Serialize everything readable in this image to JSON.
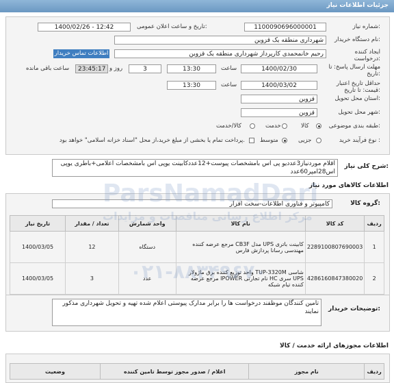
{
  "header": {
    "title": "جزئیات اطلاعات نیاز"
  },
  "form": {
    "need_number_label": "شماره نیاز:",
    "need_number": "1100090696000001",
    "announce_label": "تاریخ و ساعت اعلان عمومی:",
    "announce_value": "1400/02/26 - 12:42",
    "buyer_label": "نام دستگاه خریدار:",
    "buyer_value": "شهرداری منطقه یک قزوین",
    "creator_label": "ایجاد کننده درخواست:",
    "creator_value": "رحیم خانمحمدی کارپرداز شهرداری منطقه یک قزوین",
    "contact_link": "اطلاعات تماس خریدار",
    "deadline_label": "مهلت ارسال پاسخ: تا تاریخ:",
    "deadline_date": "1400/02/30",
    "time_label": "ساعت",
    "deadline_time": "13:30",
    "days_value": "3",
    "days_label": "روز و",
    "remaining_time": "23:45:17",
    "remaining_label": "ساعت باقی مانده",
    "validity_label": "حداقل تاریخ اعتبار قیمت: تا تاریخ:",
    "validity_date": "1400/03/02",
    "validity_time": "13:30",
    "province_label": "استان محل تحویل:",
    "province_value": "قزوین",
    "city_label": "شهر محل تحویل:",
    "city_value": "قزوین",
    "category_label": "طبقه بندی موضوعی:",
    "category_options": [
      "کالا",
      "خدمت",
      "کالا/خدمت"
    ],
    "category_selected": "کالا",
    "process_label": "نوع فرآیند خرید :",
    "process_options": [
      "جزیی",
      "متوسط"
    ],
    "process_selected": "متوسط",
    "payment_text": "پرداخت تمام یا بخشی از مبلغ خرید،از محل \"اسناد خزانه اسلامی\" خواهد بود."
  },
  "summary": {
    "label": "شرح کلی نیاز:",
    "text": "اقلام موردنیاز3عددیو پی اس بامشخصات پیوست+12عددکابینت یوپی اس بامشخصات اعلامی+باطری یوپی اس28امپر60عدد"
  },
  "goods": {
    "section_title": "اطلاعات کالاهای مورد نیاز",
    "group_label": "گروه کالا:",
    "group_value": "کامپیوتر و فناوری اطلاعات-سخت افزار",
    "columns": [
      "ردیف",
      "کد کالا",
      "نام کالا",
      "واحد شمارش",
      "تعداد / مقدار",
      "تاریخ نیاز"
    ],
    "rows": [
      {
        "idx": "1",
        "code": "2289100807690003",
        "name": "کابینت باتری UPS مدل CB3F مرجع عرضه کننده مهندسی رسانا پردازش فارس",
        "unit": "دستگاه",
        "qty": "12",
        "date": "1400/03/05"
      },
      {
        "idx": "2",
        "code": "4286160847380020",
        "name": "شاسی TUP-3320M واحد توزیع کننده برق ماژولار UPS سری HC نام تجارتی IPOWER مرجع عرضه کننده تیام شبکه",
        "unit": "عدد",
        "qty": "3",
        "date": "1400/03/05"
      }
    ]
  },
  "notes": {
    "label": "توضیحات خریدار:",
    "text": "تامین کنندگان  موظفند درخواست ها را برابر مدارک پیوستی اعلام شده  تهیه و تحویل شهرداری مذکور نمایند"
  },
  "licenses": {
    "section_title": "اطلاعات مجوزهای ارائه خدمت / کالا",
    "columns": [
      "ردیف",
      "نام مجوز",
      "اعلام / صدور مجوز توسط تامین کننده",
      "وضعیت"
    ]
  },
  "watermark": {
    "brand": "ParsNamadDari",
    "sub": "مرکز اطلاع رسانی مناقصات و مزایدات",
    "phone": "۰۲۱-۸۸۳۴۹۶۷۰"
  }
}
